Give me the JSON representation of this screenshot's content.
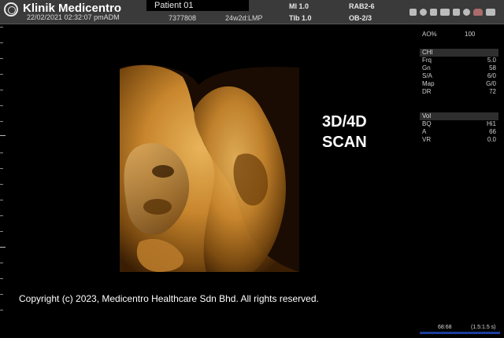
{
  "header": {
    "clinic_name": "Klinik Medicentro",
    "datetime": "22/02/2021 02:32:07 pmADM",
    "patient_name": "Patient 01",
    "patient_id": "7377808",
    "gestational_age": "24w2d:LMP",
    "mi": "MI 1.0",
    "tib": "TIb 1.0",
    "probe": "RAB2-6",
    "preset": "OB-2/3",
    "status_icons": [
      "lock-icon",
      "usb-icon",
      "wifi-icon",
      "network-icon",
      "printer-icon",
      "disk-icon",
      "cloud-icon",
      "battery-icon"
    ]
  },
  "image_label": {
    "line1": "3D/4D",
    "line2": "SCAN"
  },
  "params": {
    "ao_label": "AO%",
    "ao_value": "100",
    "chi": {
      "title": "CHI",
      "rows": [
        {
          "label": "Frq",
          "value": "5.0"
        },
        {
          "label": "Gn",
          "value": "58"
        },
        {
          "label": "S/A",
          "value": "6/0"
        },
        {
          "label": "Map",
          "value": "G/0"
        },
        {
          "label": "DR",
          "value": "72"
        }
      ]
    },
    "vol": {
      "title": "Vol",
      "rows": [
        {
          "label": "BQ",
          "value": "Hi1"
        },
        {
          "label": "A",
          "value": "66"
        },
        {
          "label": "VR",
          "value": "0.0"
        }
      ]
    }
  },
  "footer": {
    "copyright": "Copyright (c) 2023, Medicentro Healthcare Sdn Bhd. All rights reserved.",
    "cine_frames": "68:68",
    "cine_rate": "(1.5:1.5 s)"
  },
  "colors": {
    "accent_blue": "#1c3d9b",
    "skin_tone": "#c8862d"
  }
}
